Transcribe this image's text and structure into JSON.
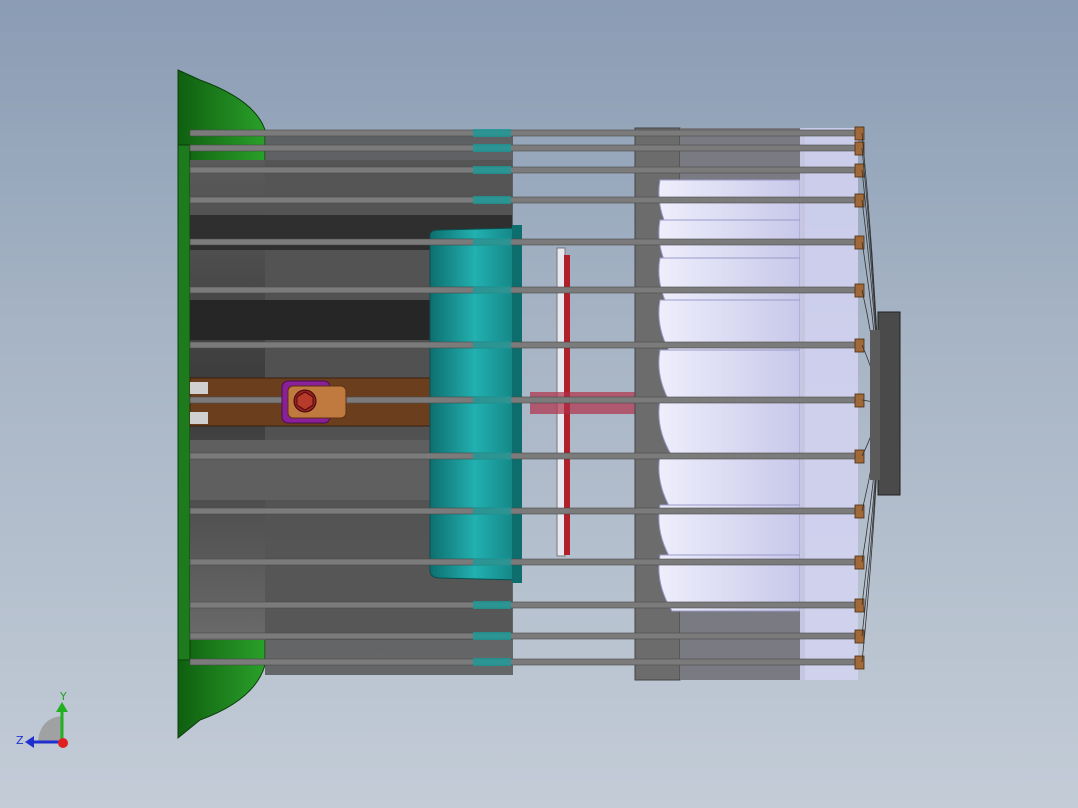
{
  "viewport": {
    "background_top": "#8a9cb4",
    "background_bottom": "#c3ccd7"
  },
  "model": {
    "colors": {
      "flange_green": "#1f8a1f",
      "flange_edge": "#0f4f0f",
      "shell_dark": "#3d3d3d",
      "shell_mid": "#6a6a6a",
      "rod_gray": "#7b7b7b",
      "teal": "#1a9b9b",
      "lavender": "#dcdcf6",
      "brown": "#6b3f1e",
      "copper": "#a0693a",
      "purple": "#8a1f9a",
      "red_plate": "#b0202a"
    }
  },
  "triad": {
    "y_label": "Y",
    "z_label": "Z",
    "icons": [
      "y-axis-arrow-icon",
      "z-axis-arrow-icon",
      "x-axis-dot-icon"
    ],
    "colors": {
      "y": "#20b020",
      "z": "#2030d0",
      "x": "#e02020"
    }
  }
}
